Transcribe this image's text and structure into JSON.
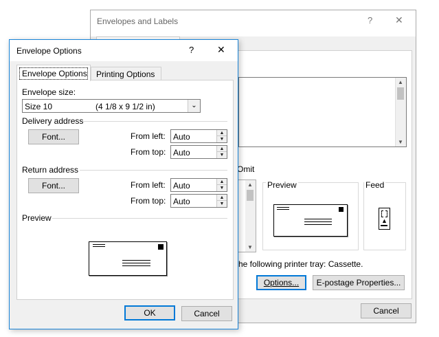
{
  "bg_dialog": {
    "title": "Envelopes and Labels",
    "help_icon": "?",
    "close_icon": "✕",
    "omit_label": "Omit",
    "preview_label": "Preview",
    "feed_label": "Feed",
    "printer_tray_text": "he following printer tray: Cassette.",
    "options_button": "Options...",
    "epostage_button": "E-postage Properties...",
    "cancel_button": "Cancel"
  },
  "dialog": {
    "title": "Envelope Options",
    "help_icon": "?",
    "close_icon": "✕",
    "tabs": [
      {
        "label": "Envelope Options",
        "active": true
      },
      {
        "label": "Printing Options",
        "active": false
      }
    ],
    "envelope_size_label": "Envelope size:",
    "envelope_size_value": "Size 10",
    "envelope_size_dims": "(4 1/8 x 9 1/2 in)",
    "delivery_address_label": "Delivery address",
    "return_address_label": "Return address",
    "font_button": "Font...",
    "from_left_label": "From left:",
    "from_top_label": "From top:",
    "delivery_from_left": "Auto",
    "delivery_from_top": "Auto",
    "return_from_left": "Auto",
    "return_from_top": "Auto",
    "preview_label": "Preview",
    "ok_button": "OK",
    "cancel_button": "Cancel"
  },
  "colors": {
    "dialog_bg": "#f0f0f0",
    "accent_border": "#0078d7"
  }
}
